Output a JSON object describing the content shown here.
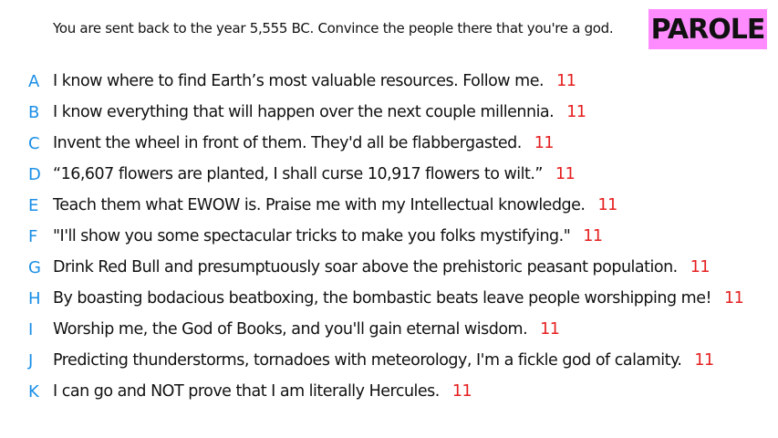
{
  "prompt": "You are sent back to the year 5,555 BC. Convince the people there that you're a god.",
  "badge": "PAROLE",
  "colors": {
    "letter": "#1a8fe6",
    "score": "#e51f1f",
    "badge_bg": "#ff8cff"
  },
  "answers": [
    {
      "letter": "A",
      "text": "I know where to find Earth’s most valuable resources. Follow me.",
      "score": "11"
    },
    {
      "letter": "B",
      "text": "I know everything that will happen over the next couple millennia.",
      "score": "11"
    },
    {
      "letter": "C",
      "text": "Invent the wheel in front of them. They'd all be flabbergasted.",
      "score": "11"
    },
    {
      "letter": "D",
      "text": "“16,607 flowers are planted, I shall curse 10,917 flowers to wilt.”",
      "score": "11"
    },
    {
      "letter": "E",
      "text": "Teach them what EWOW is. Praise me with my Intellectual knowledge.",
      "score": "11"
    },
    {
      "letter": "F",
      "text": "\"I'll show you some spectacular tricks to make you folks mystifying.\"",
      "score": "11"
    },
    {
      "letter": "G",
      "text": "Drink Red Bull and presumptuously soar above the prehistoric peasant population.",
      "score": "11"
    },
    {
      "letter": "H",
      "text": "By boasting bodacious beatboxing, the bombastic beats leave people worshipping me!",
      "score": "11"
    },
    {
      "letter": "I",
      "text": "Worship me, the God of Books, and you'll gain eternal wisdom.",
      "score": "11"
    },
    {
      "letter": "J",
      "text": "Predicting thunderstorms, tornadoes with meteorology, I'm a fickle god of calamity.",
      "score": "11"
    },
    {
      "letter": "K",
      "text": "I can go and NOT prove that I am literally Hercules.",
      "score": "11"
    }
  ]
}
